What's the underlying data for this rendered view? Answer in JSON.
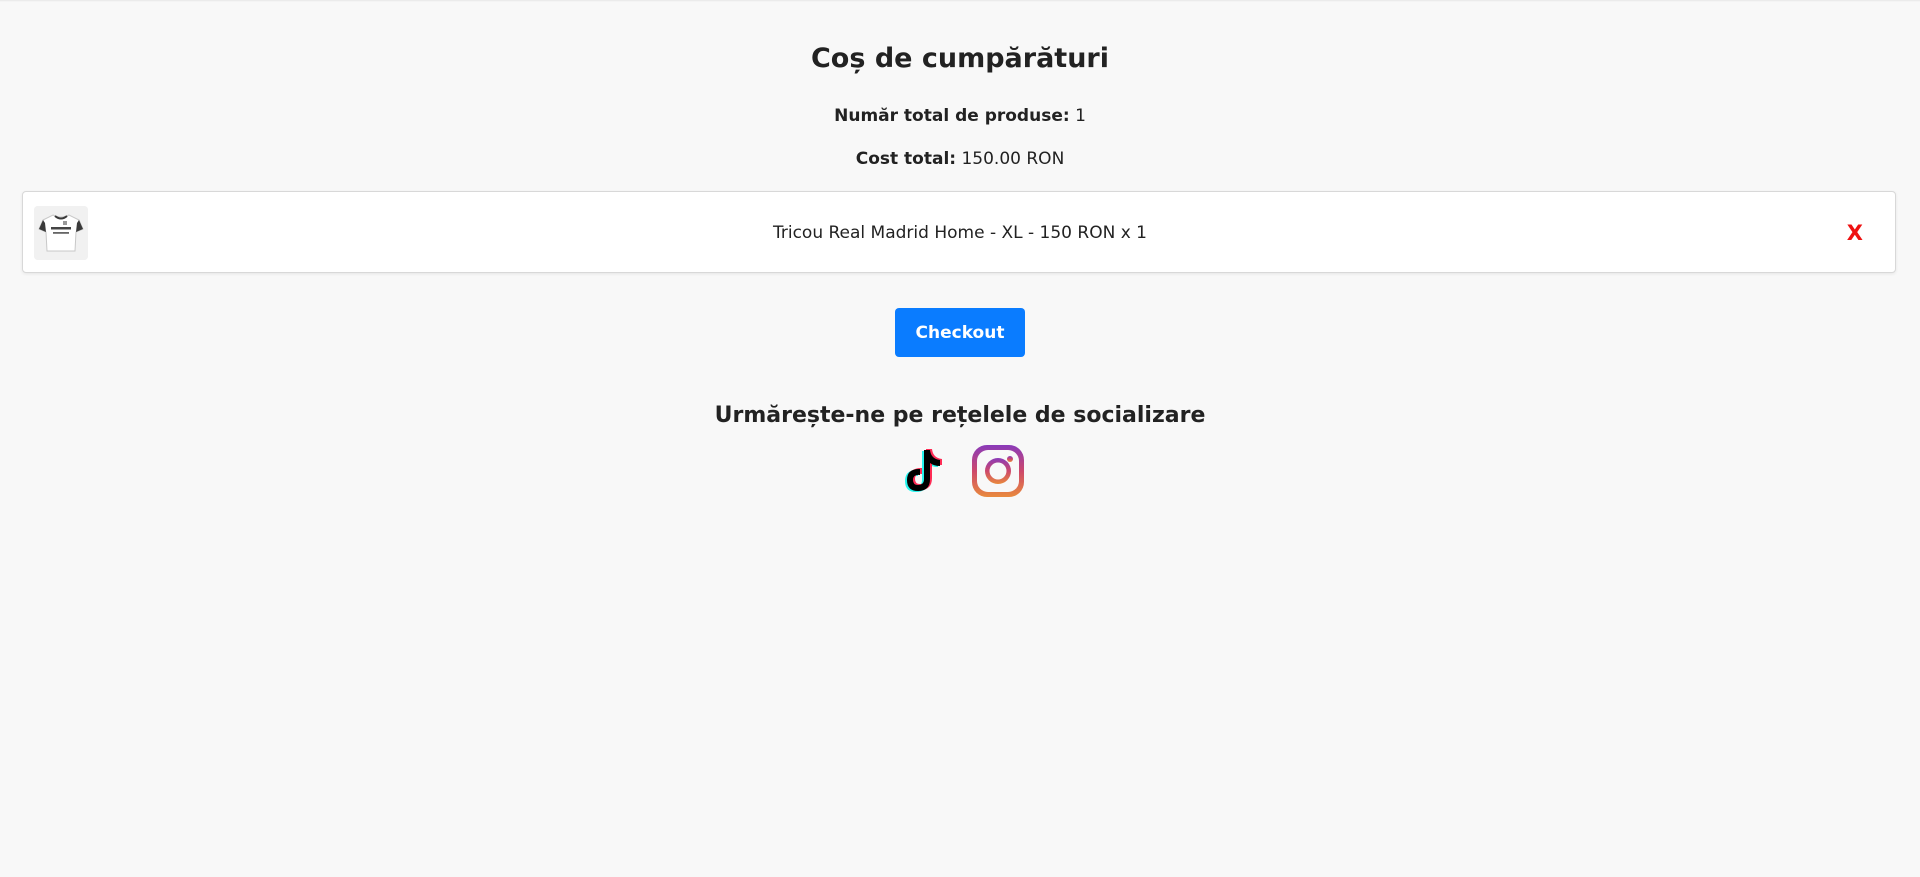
{
  "cart": {
    "title": "Coș de cumpărături",
    "count_label": "Număr total de produse:",
    "count_value": "1",
    "cost_label": "Cost total:",
    "cost_value": "150.00 RON",
    "items": [
      {
        "description": "Tricou Real Madrid Home - XL - 150 RON x 1",
        "remove_label": "X"
      }
    ],
    "checkout_label": "Checkout"
  },
  "social": {
    "title": "Urmărește-ne pe rețelele de socializare",
    "icons": [
      "tiktok-icon",
      "instagram-icon"
    ]
  },
  "colors": {
    "background": "#f8f8f8",
    "checkout": "#0a7cff",
    "remove": "#ee1111"
  }
}
